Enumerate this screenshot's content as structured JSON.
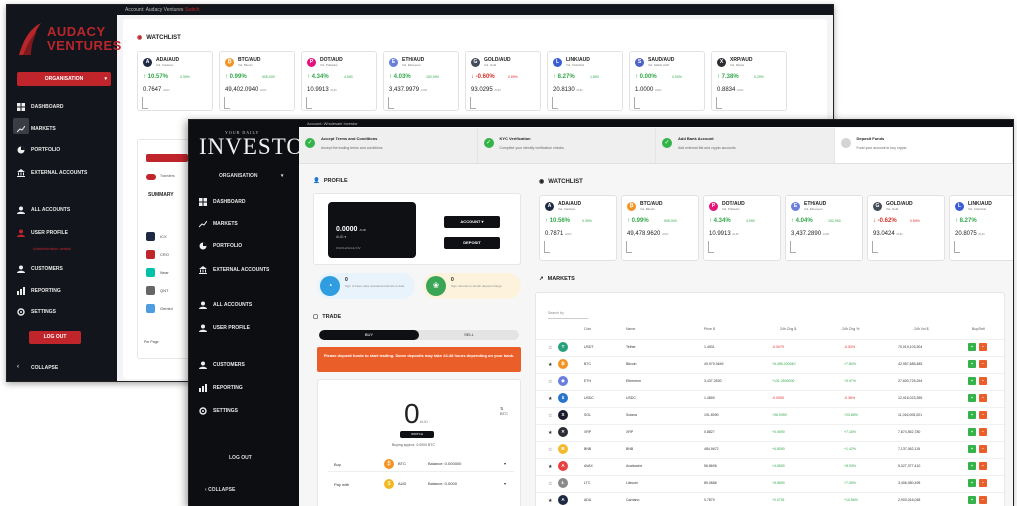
{
  "back_window": {
    "brand": {
      "line1": "AUDACY",
      "line2": "VENTURES"
    },
    "topbar": {
      "account_label": "Account: Audacy Ventures",
      "extra": "Switch"
    },
    "organisation_label": "ORGANISATION",
    "nav": [
      {
        "label": "DASHBOARD",
        "icon": "dashboard-icon"
      },
      {
        "label": "MARKETS",
        "icon": "chart-icon"
      },
      {
        "label": "PORTFOLIO",
        "icon": "pie-icon"
      },
      {
        "label": "EXTERNAL ACCOUNTS",
        "icon": "bank-icon"
      },
      {
        "label": "ALL ACCOUNTS",
        "icon": "users-icon"
      },
      {
        "label": "USER PROFILE",
        "icon": "user-icon"
      },
      {
        "label": "CUSTOMERS",
        "icon": "customers-icon"
      },
      {
        "label": "REPORTING",
        "icon": "reporting-icon"
      },
      {
        "label": "SETTINGS",
        "icon": "gear-icon"
      }
    ],
    "sub_nav": "Administration details",
    "logout_label": "LOG OUT",
    "collapse_label": "COLLAPSE",
    "watchlist_title": "WATCHLIST",
    "watchlist": [
      {
        "pair": "ADA/AUD",
        "sub": "Vol. Cardano",
        "pct": "↑ 10.57%",
        "vol": "0.39%",
        "price": "0.7647",
        "unit": "AUD",
        "dir": "up",
        "color": "#1e2a44",
        "sym": "A"
      },
      {
        "pair": "BTC/AUD",
        "sub": "Vol. Bitcoin",
        "pct": "↑ 0.99%",
        "vol": "905,000",
        "price": "49,402.0940",
        "unit": "AUD",
        "dir": "up",
        "color": "#f29424",
        "sym": "₿"
      },
      {
        "pair": "DOT/AUD",
        "sub": "Vol. Polkadot",
        "pct": "↑ 4.34%",
        "vol": "4,990",
        "price": "10.9913",
        "unit": "AUD",
        "dir": "up",
        "color": "#e5137c",
        "sym": "P"
      },
      {
        "pair": "ETH/AUD",
        "sub": "Vol. Ethereum",
        "pct": "↑ 4.03%",
        "vol": "152,990",
        "price": "3,437.9979",
        "unit": "AUD",
        "dir": "up",
        "color": "#6a7fdb",
        "sym": "E"
      },
      {
        "pair": "GOLD/AUD",
        "sub": "Vol. Gold",
        "pct": "↓ -0.60%",
        "vol": "0.89%",
        "price": "93.0295",
        "unit": "AUD",
        "dir": "down",
        "color": "#444c5a",
        "sym": "G"
      },
      {
        "pair": "LINK/AUD",
        "sub": "Vol. Chainlink",
        "pct": "↑ 8.27%",
        "vol": "1,890",
        "price": "20.8130",
        "unit": "AUD",
        "dir": "up",
        "color": "#3a5cd4",
        "sym": "L"
      },
      {
        "pair": "SAUD/AUD",
        "sub": "Vol. Stable AUD",
        "pct": "↑ 0.00%",
        "vol": "0.00%",
        "price": "1.0000",
        "unit": "AUD",
        "dir": "up",
        "color": "#4f62c8",
        "sym": "S"
      },
      {
        "pair": "XRP/AUD",
        "sub": "Vol. Ripple",
        "pct": "↑ 7.38%",
        "vol": "0.29%",
        "price": "0.8834",
        "unit": "AUD",
        "dir": "up",
        "color": "#2a2d34",
        "sym": "X"
      }
    ],
    "panel": {
      "toggle_label": "Transfers",
      "section": "SUMMARY",
      "items": [
        "ICX",
        "CRO",
        "Near",
        "QNT",
        "Gemini"
      ],
      "per_page": "Per Page"
    }
  },
  "front_window": {
    "brand": {
      "pre": "YOUR DAILY",
      "main": "INVESTOR"
    },
    "topbar": {
      "account_label": "Account: Wholesale Investor"
    },
    "organisation_label": "ORGANISATION",
    "nav": [
      {
        "label": "DASHBOARD",
        "icon": "dashboard-icon"
      },
      {
        "label": "MARKETS",
        "icon": "chart-icon"
      },
      {
        "label": "PORTFOLIO",
        "icon": "pie-icon"
      },
      {
        "label": "EXTERNAL ACCOUNTS",
        "icon": "bank-icon"
      },
      {
        "label": "ALL ACCOUNTS",
        "icon": "users-icon"
      },
      {
        "label": "USER PROFILE",
        "icon": "user-icon"
      },
      {
        "label": "CUSTOMERS",
        "icon": "customers-icon"
      },
      {
        "label": "REPORTING",
        "icon": "reporting-icon"
      },
      {
        "label": "SETTINGS",
        "icon": "gear-icon"
      }
    ],
    "logout_label": "LOG OUT",
    "collapse_label": "COLLAPSE",
    "steps": [
      {
        "title": "Accept Terms and Conditions",
        "desc": "Accept the trading terms and conditions",
        "done": true
      },
      {
        "title": "KYC Verification",
        "desc": "Complete your identity verification checks",
        "done": true
      },
      {
        "title": "Add Bank Account",
        "desc": "Add external fiat and crypto accounts",
        "done": true
      },
      {
        "title": "Deposit Funds",
        "desc": "Fund your account to buy crypto",
        "done": false
      }
    ],
    "profile": {
      "title": "PROFILE",
      "balance": "0.0000",
      "balance_unit": "AUD",
      "currency": "AUD",
      "account_id": "WHOLESALE INV",
      "account_btn": "ACCOUNT",
      "deposit_btn": "DEPOSIT"
    },
    "referrals": [
      {
        "count": "0",
        "text": "Sign of base value activated referrals to date",
        "bg": "#e8f3fb",
        "circle": "#2f9de0",
        "sym": "◔"
      },
      {
        "count": "0",
        "text": "Sign referred to similar deposit charge",
        "bg": "#fdf3dc",
        "circle": "#3aa655",
        "sym": "❀"
      }
    ],
    "trade": {
      "title": "TRADE",
      "buy_tab": "BUY",
      "sell_tab": "SELL",
      "warning": "Please deposit funds to start trading. Some deposits may take 24-48 hours depending on your bank.",
      "amount": "0",
      "amount_unit": "AUD",
      "alt_unit": "BTC",
      "swap_label": "SWITCH",
      "approx": "Buying approx. 0.0000 BTC",
      "rows": [
        {
          "key": "Buy",
          "coin": "BTC",
          "coin_color": "#f29424",
          "sym": "₿",
          "balance": "Balance: 0.000000"
        },
        {
          "key": "Pay with",
          "coin": "AUD",
          "coin_color": "#f2b824",
          "sym": "$",
          "balance": "Balance: 0.0000"
        }
      ]
    },
    "watchlist_title": "WATCHLIST",
    "watchlist": [
      {
        "pair": "ADA/AUD",
        "sub": "Vol. Cardano",
        "pct": "↑ 10.56%",
        "vol": "0.39%",
        "price": "0.7871",
        "unit": "AUD",
        "dir": "up",
        "color": "#1e2a44",
        "sym": "A"
      },
      {
        "pair": "BTC/AUD",
        "sub": "Vol. Bitcoin",
        "pct": "↑ 0.99%",
        "vol": "905,000",
        "price": "49,478.9620",
        "unit": "AUD",
        "dir": "up",
        "color": "#f29424",
        "sym": "₿"
      },
      {
        "pair": "DOT/AUD",
        "sub": "Vol. Polkadot",
        "pct": "↑ 4.34%",
        "vol": "4,990",
        "price": "10.9913",
        "unit": "AUD",
        "dir": "up",
        "color": "#e5137c",
        "sym": "P"
      },
      {
        "pair": "ETH/AUD",
        "sub": "Vol. Ethereum",
        "pct": "↑ 4.04%",
        "vol": "152,990",
        "price": "3,437.2890",
        "unit": "AUD",
        "dir": "up",
        "color": "#6a7fdb",
        "sym": "E"
      },
      {
        "pair": "GOLD/AUD",
        "sub": "Vol. Gold",
        "pct": "↓ -0.62%",
        "vol": "0.89%",
        "price": "93.0424",
        "unit": "AUD",
        "dir": "down",
        "color": "#444c5a",
        "sym": "G"
      },
      {
        "pair": "LINK/AUD",
        "sub": "Vol. Chainlink",
        "pct": "↑ 8.27%",
        "vol": "",
        "price": "20.8075",
        "unit": "AUD",
        "dir": "up",
        "color": "#3a5cd4",
        "sym": "L"
      }
    ],
    "markets": {
      "title": "MARKETS",
      "search_placeholder": "Search by",
      "columns": [
        "Coin",
        "Name",
        "Price $",
        "24h Chg $",
        "24h Chg %",
        "24h Vol $",
        "Buy/Sell"
      ],
      "rows": [
        {
          "coin": "USDT",
          "name": "Tether",
          "price": "1.4931",
          "chg": "-0.0079",
          "pct": "-0.53%",
          "vol": "70,019,103,304",
          "dir": "down",
          "color": "#26a17b",
          "sym": "T"
        },
        {
          "coin": "BTC",
          "name": "Bitcoin",
          "price": "49,979.3649",
          "chg": "+6,495.200040",
          "pct": "+7.80%",
          "vol": "42,957,685,485",
          "dir": "up",
          "color": "#f29424",
          "sym": "₿"
        },
        {
          "coin": "ETH",
          "name": "Ethereum",
          "price": "3,437.2530",
          "chg": "+131.2590000",
          "pct": "+3.97%",
          "vol": "27,600,725,294",
          "dir": "up",
          "color": "#6a7fdb",
          "sym": "◆"
        },
        {
          "coin": "USDC",
          "name": "USDC",
          "price": "1.4890",
          "chg": "-0.0053",
          "pct": "-0.36%",
          "vol": "12,016,023,395",
          "dir": "down",
          "color": "#2775ca",
          "sym": "$"
        },
        {
          "coin": "SOL",
          "name": "Solana",
          "price": "191.8090",
          "chg": "+36.9390",
          "pct": "+23.86%",
          "vol": "11,016,005,001",
          "dir": "up",
          "color": "#1b1b2f",
          "sym": "S"
        },
        {
          "coin": "XRP",
          "name": "XRP",
          "price": "0.8827",
          "chg": "+0.0590",
          "pct": "+7.16%",
          "vol": "7,874,552,780",
          "dir": "up",
          "color": "#2a2d34",
          "sym": "✕"
        },
        {
          "coin": "BNB",
          "name": "BNB",
          "price": "484.9672",
          "chg": "+6.8090",
          "pct": "+1.42%",
          "vol": "7,137,062,115",
          "dir": "up",
          "color": "#f3ba2f",
          "sym": "B"
        },
        {
          "coin": "AVAX",
          "name": "Avalanche",
          "price": "56.8696",
          "chg": "+4.6590",
          "pct": "+8.93%",
          "vol": "5,027,377,410",
          "dir": "up",
          "color": "#e84142",
          "sym": "A"
        },
        {
          "coin": "LTC",
          "name": "Litecoin",
          "price": "89.0686",
          "chg": "+5.8690",
          "pct": "+7.05%",
          "vol": "3,406,080,495",
          "dir": "up",
          "color": "#8a8a8a",
          "sym": "Ł"
        },
        {
          "coin": "ADA",
          "name": "Cardano",
          "price": "0.7870",
          "chg": "+0.0751",
          "pct": "+10.56%",
          "vol": "2,903,016,048",
          "dir": "up",
          "color": "#1e2a44",
          "sym": "A"
        }
      ]
    }
  }
}
